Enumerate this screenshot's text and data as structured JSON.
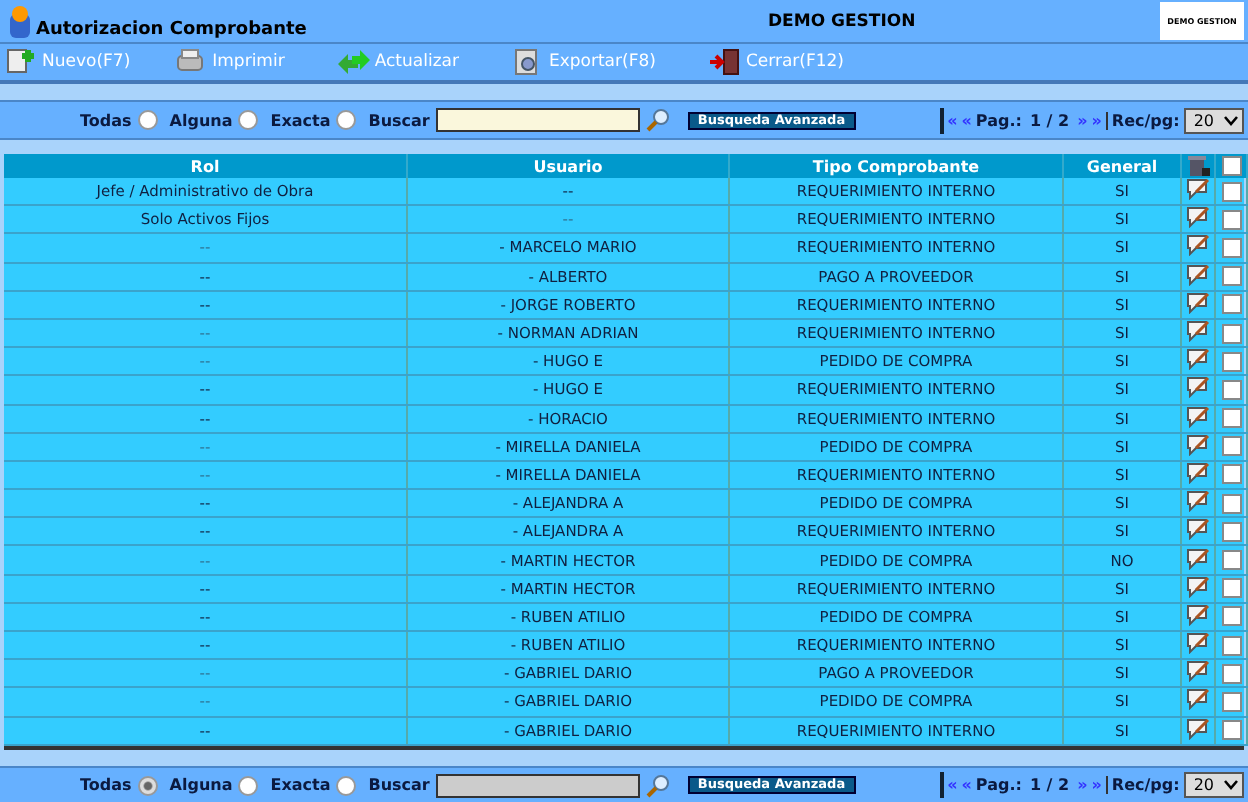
{
  "window": {
    "title": "Autorizacion Comprobante",
    "company": "DEMO GESTION",
    "logo_text": "DEMO GESTION"
  },
  "toolbar": [
    {
      "label": "Nuevo(F7)",
      "kind": "new"
    },
    {
      "label": "Imprimir",
      "kind": "print"
    },
    {
      "label": "Actualizar",
      "kind": "refresh"
    },
    {
      "label": "Exportar(F8)",
      "kind": "export"
    },
    {
      "label": "Cerrar(F12)",
      "kind": "close"
    }
  ],
  "search_bars": [
    {
      "options": [
        {
          "label": "Todas",
          "selected": false
        },
        {
          "label": "Alguna",
          "selected": false
        },
        {
          "label": "Exacta",
          "selected": false
        }
      ],
      "search_label": "Buscar",
      "focused": true,
      "advanced": "Busqueda Avanzada",
      "pager": {
        "first": "«",
        "prev": "«",
        "label": "Pag.:",
        "page": "1 / 2",
        "next": "»",
        "last": "»"
      },
      "records_label": "Rec/pg:",
      "records": "20"
    },
    {
      "options": [
        {
          "label": "Todas",
          "selected": true
        },
        {
          "label": "Alguna",
          "selected": false
        },
        {
          "label": "Exacta",
          "selected": false
        }
      ],
      "search_label": "Buscar",
      "focused": false,
      "advanced": "Busqueda Avanzada",
      "pager": {
        "first": "«",
        "prev": "«",
        "label": "Pag.:",
        "page": "1 / 2",
        "next": "»",
        "last": "»"
      },
      "records_label": "Rec/pg:",
      "records": "20"
    }
  ],
  "table": {
    "columns": [
      "Rol",
      "Usuario",
      "Tipo Comprobante",
      "General"
    ],
    "select_all": {
      "checked": false
    },
    "rows": [
      {
        "rol": "Jefe / Administrativo de Obra",
        "rol_muted": false,
        "user": "--",
        "user_muted": false,
        "type": "REQUERIMIENTO INTERNO",
        "general": "SI",
        "checked": false
      },
      {
        "rol": "Solo Activos Fijos",
        "rol_muted": false,
        "user": "--",
        "user_muted": true,
        "type": "REQUERIMIENTO INTERNO",
        "general": "SI",
        "checked": false
      },
      {
        "rol": "--",
        "rol_muted": true,
        "user": "- MARCELO MARIO",
        "user_muted": false,
        "type": "REQUERIMIENTO INTERNO",
        "general": "SI",
        "checked": false
      },
      {
        "rol": "--",
        "rol_muted": false,
        "user": "- ALBERTO",
        "user_muted": false,
        "type": "PAGO A PROVEEDOR",
        "general": "SI",
        "checked": false
      },
      {
        "rol": "--",
        "rol_muted": false,
        "user": "- JORGE ROBERTO",
        "user_muted": false,
        "type": "REQUERIMIENTO INTERNO",
        "general": "SI",
        "checked": false
      },
      {
        "rol": "--",
        "rol_muted": true,
        "user": "- NORMAN ADRIAN",
        "user_muted": false,
        "type": "REQUERIMIENTO INTERNO",
        "general": "SI",
        "checked": false
      },
      {
        "rol": "--",
        "rol_muted": true,
        "user": "- HUGO E",
        "user_muted": false,
        "type": "PEDIDO DE COMPRA",
        "general": "SI",
        "checked": false
      },
      {
        "rol": "--",
        "rol_muted": false,
        "user": "- HUGO E",
        "user_muted": false,
        "type": "REQUERIMIENTO INTERNO",
        "general": "SI",
        "checked": false
      },
      {
        "rol": "--",
        "rol_muted": false,
        "user": "- HORACIO",
        "user_muted": false,
        "type": "REQUERIMIENTO INTERNO",
        "general": "SI",
        "checked": false
      },
      {
        "rol": "--",
        "rol_muted": true,
        "user": "- MIRELLA DANIELA",
        "user_muted": false,
        "type": "PEDIDO DE COMPRA",
        "general": "SI",
        "checked": false
      },
      {
        "rol": "--",
        "rol_muted": true,
        "user": "- MIRELLA DANIELA",
        "user_muted": false,
        "type": "REQUERIMIENTO INTERNO",
        "general": "SI",
        "checked": false
      },
      {
        "rol": "--",
        "rol_muted": false,
        "user": "- ALEJANDRA A",
        "user_muted": false,
        "type": "PEDIDO DE COMPRA",
        "general": "SI",
        "checked": false
      },
      {
        "rol": "--",
        "rol_muted": false,
        "user": "- ALEJANDRA A",
        "user_muted": false,
        "type": "REQUERIMIENTO INTERNO",
        "general": "SI",
        "checked": false
      },
      {
        "rol": "--",
        "rol_muted": true,
        "user": "- MARTIN HECTOR",
        "user_muted": false,
        "type": "PEDIDO DE COMPRA",
        "general": "NO",
        "checked": false
      },
      {
        "rol": "--",
        "rol_muted": false,
        "user": "- MARTIN HECTOR",
        "user_muted": false,
        "type": "REQUERIMIENTO INTERNO",
        "general": "SI",
        "checked": false
      },
      {
        "rol": "--",
        "rol_muted": false,
        "user": "- RUBEN ATILIO",
        "user_muted": false,
        "type": "PEDIDO DE COMPRA",
        "general": "SI",
        "checked": false
      },
      {
        "rol": "--",
        "rol_muted": false,
        "user": "- RUBEN ATILIO",
        "user_muted": false,
        "type": "REQUERIMIENTO INTERNO",
        "general": "SI",
        "checked": false
      },
      {
        "rol": "--",
        "rol_muted": true,
        "user": "- GABRIEL DARIO",
        "user_muted": false,
        "type": "PAGO A PROVEEDOR",
        "general": "SI",
        "checked": false
      },
      {
        "rol": "--",
        "rol_muted": true,
        "user": "- GABRIEL DARIO",
        "user_muted": false,
        "type": "PEDIDO DE COMPRA",
        "general": "SI",
        "checked": false
      },
      {
        "rol": "--",
        "rol_muted": false,
        "user": "- GABRIEL DARIO",
        "user_muted": false,
        "type": "REQUERIMIENTO INTERNO",
        "general": "SI",
        "checked": false
      }
    ]
  }
}
